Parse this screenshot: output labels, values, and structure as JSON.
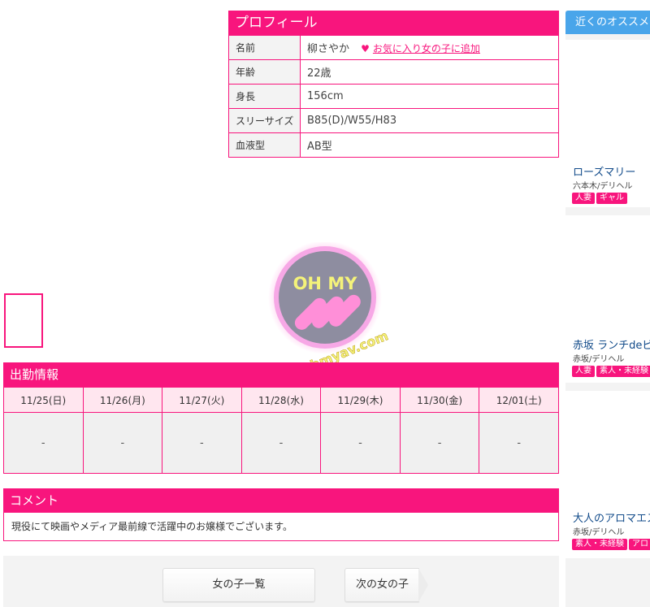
{
  "profile": {
    "title": "プロフィール",
    "rows": [
      {
        "label": "名前",
        "value": "柳さやか"
      },
      {
        "label": "年齢",
        "value": "22歳"
      },
      {
        "label": "身長",
        "value": "156cm"
      },
      {
        "label": "スリーサイズ",
        "value": "B85(D)/W55/H83"
      },
      {
        "label": "血液型",
        "value": "AB型"
      }
    ],
    "favorite_link": "お気に入り女の子に追加"
  },
  "watermark": {
    "top_text": "OH MY",
    "url_text": "www.ohmyav.com"
  },
  "schedule": {
    "title": "出勤情報",
    "days": [
      "11/25(日)",
      "11/26(月)",
      "11/27(火)",
      "11/28(水)",
      "11/29(木)",
      "11/30(金)",
      "12/01(土)"
    ],
    "slots": [
      "-",
      "-",
      "-",
      "-",
      "-",
      "-",
      "-"
    ]
  },
  "comment": {
    "title": "コメント",
    "text": "現役にて映画やメディア最前線で活躍中のお嬢様でございます。"
  },
  "nav": {
    "list_label": "女の子一覧",
    "next_label": "次の女の子"
  },
  "sidebar": {
    "title": "近くのオススメ",
    "cards": [
      {
        "name": "ローズマリー",
        "area": "六本木/デリヘル",
        "tags": [
          "人妻",
          "ギャル"
        ]
      },
      {
        "name": "赤坂 ランチdeビン",
        "area": "赤坂/デリヘル",
        "tags": [
          "人妻",
          "素人・未経験"
        ]
      },
      {
        "name": "大人のアロマエス",
        "area": "赤坂/デリヘル",
        "tags": [
          "素人・未経験",
          "アロ"
        ]
      }
    ]
  },
  "colors": {
    "accent": "#f8157d",
    "sidebar_header": "#49a5ea"
  }
}
